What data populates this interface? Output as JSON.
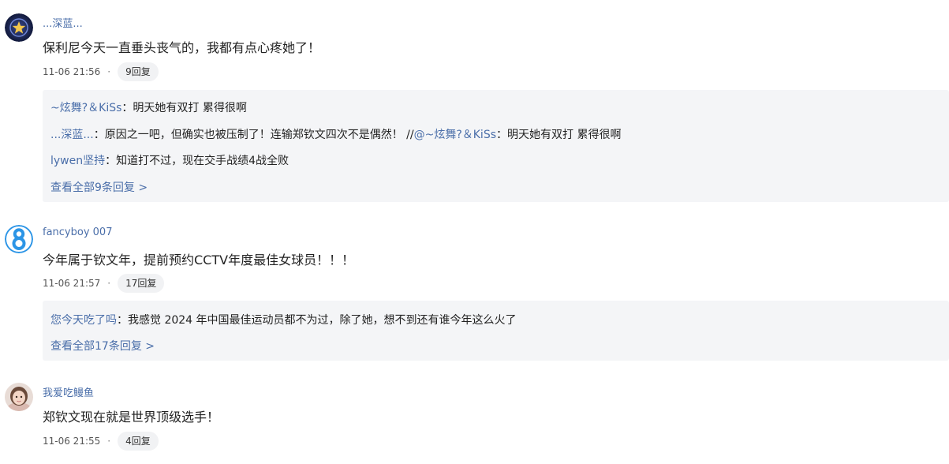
{
  "comments": [
    {
      "username": "...深蓝...",
      "text": "保利尼今天一直垂头丧气的，我都有点心疼她了！",
      "time": "11-06 21:56",
      "dot": "·",
      "reply_count": "9回复",
      "avatar_icon": "star-badge-avatar",
      "replies": [
        {
          "user": "~炫舞?＆KiSs",
          "sep": "：",
          "text": "明天她有双打 累得很啊"
        },
        {
          "user": "...深蓝...",
          "sep": "：",
          "text": "原因之一吧，但确实也被压制了！连输郑钦文四次不是偶然！ //",
          "mention": "@~炫舞?＆KiSs",
          "text2": "：明天她有双打 累得很啊"
        },
        {
          "user": "lywen坚持",
          "sep": "：",
          "text": "知道打不过，现在交手战绩4战全败"
        }
      ],
      "view_all": "查看全部9条回复 >"
    },
    {
      "username": "fancyboy 007",
      "text": "今年属于钦文年，提前预约CCTV年度最佳女球员！！！",
      "time": "11-06 21:57",
      "dot": "·",
      "reply_count": "17回复",
      "avatar_icon": "number-8-avatar",
      "avatar_glyph": "8",
      "replies": [
        {
          "user": "您今天吃了吗",
          "sep": "：",
          "text": "我感觉 2024 年中国最佳运动员都不为过，除了她，想不到还有谁今年这么火了"
        }
      ],
      "view_all": "查看全部17条回复 >"
    },
    {
      "username": "我爱吃鳗鱼",
      "text": "郑钦文现在就是世界顶级选手！",
      "time": "11-06 21:55",
      "dot": "·",
      "reply_count": "4回复",
      "avatar_icon": "girl-photo-avatar"
    }
  ],
  "colors": {
    "link": "#4a6ea9",
    "reply_bg": "#f4f5f7",
    "pill_bg": "#f1f2f4"
  }
}
